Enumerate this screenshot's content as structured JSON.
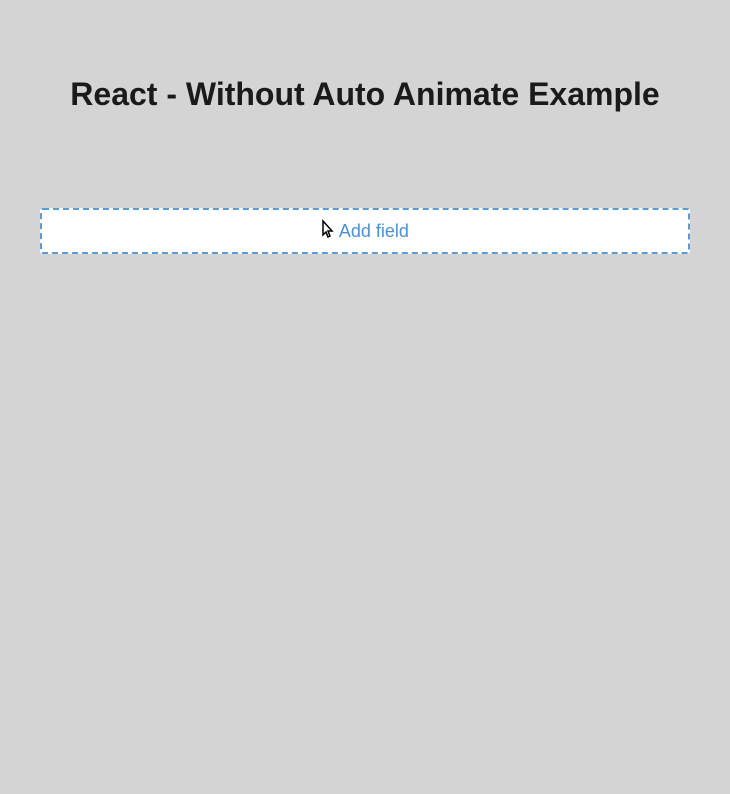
{
  "header": {
    "title": "React - Without Auto Animate Example"
  },
  "addField": {
    "label": "Add field",
    "icon": "+"
  }
}
